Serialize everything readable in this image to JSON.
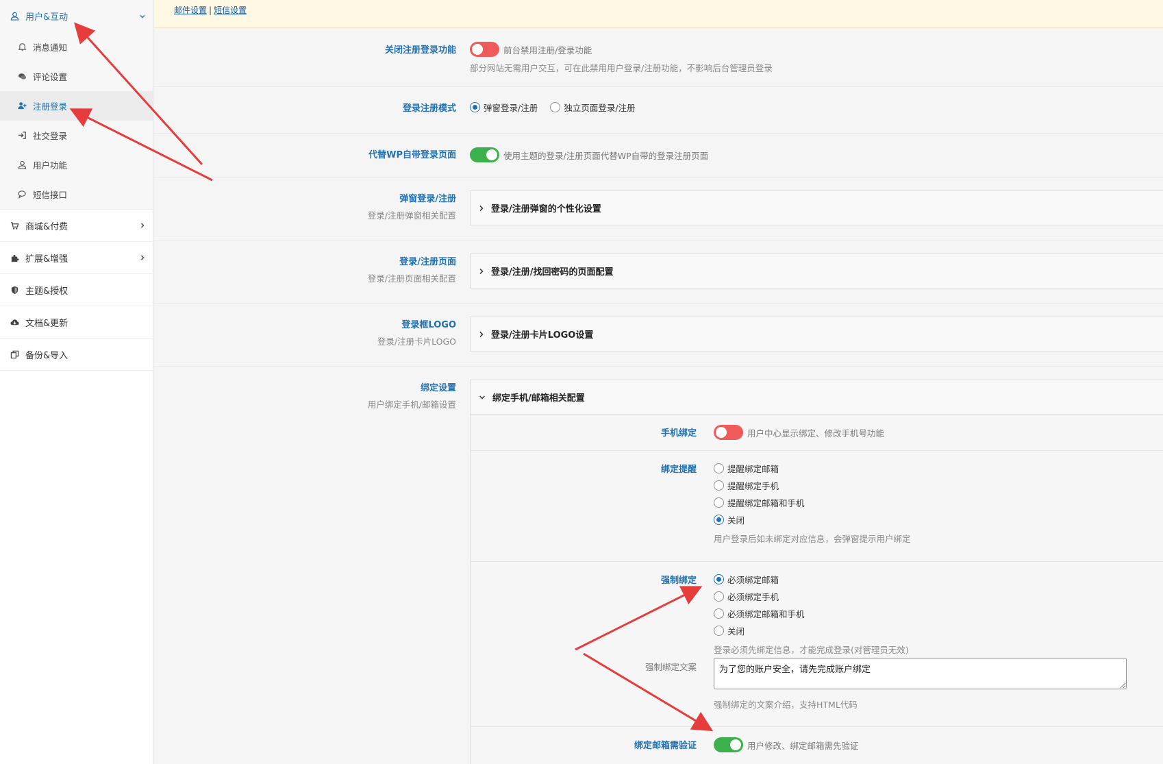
{
  "sidebar": {
    "user_group": {
      "label": "用户&互动",
      "items": [
        {
          "label": "消息通知",
          "icon": "bell-icon"
        },
        {
          "label": "评论设置",
          "icon": "comments-icon"
        },
        {
          "label": "注册登录",
          "icon": "user-plus-icon"
        },
        {
          "label": "社交登录",
          "icon": "sign-in-icon"
        },
        {
          "label": "用户功能",
          "icon": "user-icon"
        },
        {
          "label": "短信接口",
          "icon": "sms-icon"
        }
      ]
    },
    "groups": [
      {
        "label": "商城&付费",
        "icon": "cart-icon"
      },
      {
        "label": "扩展&增强",
        "icon": "puzzle-icon"
      },
      {
        "label": "主题&授权",
        "icon": "shield-icon"
      },
      {
        "label": "文档&更新",
        "icon": "cloud-icon"
      },
      {
        "label": "备份&导入",
        "icon": "copy-icon"
      }
    ]
  },
  "notice": {
    "link1": "邮件设置",
    "sep": "|",
    "link2": "短信设置"
  },
  "fields": {
    "disable_reg": {
      "title": "关闭注册登录功能",
      "toggle_label": "前台禁用注册/登录功能",
      "desc": "部分网站无需用户交互，可在此禁用用户登录/注册功能，不影响后台管理员登录",
      "state": "off"
    },
    "login_mode": {
      "title": "登录注册模式",
      "opt1": "弹窗登录/注册",
      "opt2": "独立页面登录/注册",
      "selected": 1
    },
    "replace_wp": {
      "title": "代替WP自带登录页面",
      "toggle_label": "使用主题的登录/注册页面代替WP自带的登录注册页面",
      "state": "on"
    },
    "popup": {
      "title": "弹窗登录/注册",
      "desc": "登录/注册弹窗相关配置",
      "panel": "登录/注册弹窗的个性化设置"
    },
    "page": {
      "title": "登录/注册页面",
      "desc": "登录/注册页面相关配置",
      "panel": "登录/注册/找回密码的页面配置"
    },
    "logo": {
      "title": "登录框LOGO",
      "desc": "登录/注册卡片LOGO",
      "panel": "登录/注册卡片LOGO设置"
    },
    "bind": {
      "title": "绑定设置",
      "desc": "用户绑定手机/邮箱设置",
      "panel": "绑定手机/邮箱相关配置",
      "phone": {
        "title": "手机绑定",
        "toggle_label": "用户中心显示绑定、修改手机号功能",
        "state": "off"
      },
      "remind": {
        "title": "绑定提醒",
        "options": [
          "提醒绑定邮箱",
          "提醒绑定手机",
          "提醒绑定邮箱和手机",
          "关闭"
        ],
        "selected": 4,
        "desc": "用户登录后如未绑定对应信息，会弹窗提示用户绑定"
      },
      "force": {
        "title": "强制绑定",
        "options": [
          "必须绑定邮箱",
          "必须绑定手机",
          "必须绑定邮箱和手机",
          "关闭"
        ],
        "selected": 1,
        "desc": "登录必须先绑定信息，才能完成登录(对管理员无效)",
        "copy_label": "强制绑定文案",
        "copy_value": "为了您的账户安全，请先完成账户绑定",
        "copy_desc": "强制绑定的文案介绍，支持HTML代码"
      },
      "verify": {
        "title": "绑定邮箱需验证",
        "toggle_label": "用户修改、绑定邮箱需先验证",
        "state": "on"
      }
    }
  },
  "colors": {
    "accent": "#2271b1",
    "toggle_on": "#3cb04a",
    "toggle_off": "#ef5b5b",
    "annotation_arrow": "#e63c3c"
  }
}
